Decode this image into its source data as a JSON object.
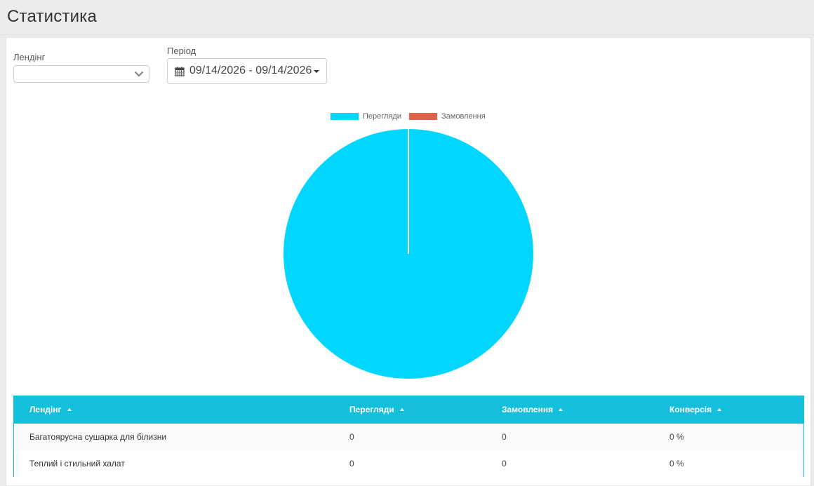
{
  "page": {
    "title": "Статистика"
  },
  "filters": {
    "landing_label": "Лендінг",
    "landing_value": "",
    "period_label": "Період",
    "period_value": "09/14/2026 - 09/14/2026"
  },
  "chart_data": {
    "type": "pie",
    "categories": [
      "Перегляди",
      "Замовлення"
    ],
    "values": [
      100,
      0
    ],
    "colors": [
      "#00d6ff",
      "#e0614a"
    ],
    "legend": "top"
  },
  "table": {
    "columns": [
      "Лендінг",
      "Перегляди",
      "Замовлення",
      "Конверсія"
    ],
    "rows": [
      [
        "Багатоярусна сушарка для білизни",
        "0",
        "0",
        "0 %"
      ],
      [
        "Теплий і стильний халат",
        "0",
        "0",
        "0 %"
      ]
    ]
  },
  "colors": {
    "accent": "#14bfdc"
  }
}
